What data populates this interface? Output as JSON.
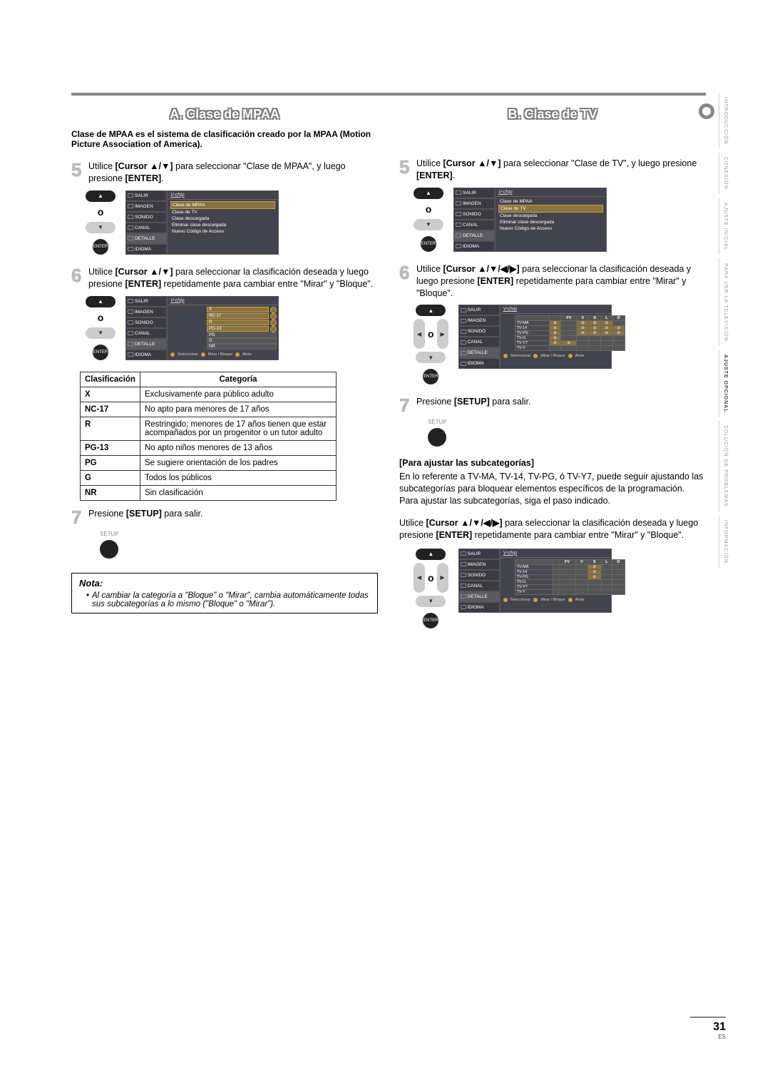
{
  "page": {
    "number": "31",
    "lang": "ES"
  },
  "sidetabs": [
    "INTRODUCCIÓN",
    "CONEXIÓN",
    "AJUSTE INICIAL",
    "PARA VER LA TELEVISIÓN",
    "AJUSTE OPCIONAL",
    "SOLUCIÓN DE PROBLEMAS",
    "INFORMACIÓN"
  ],
  "active_tab_index": 4,
  "sectionA": {
    "title": "A.  Clase de MPAA",
    "intro": "Clase de MPAA es el sistema de clasificación creado por la MPAA (Motion Picture Association of America).",
    "step5_pre": "Utilice ",
    "step5_cmd": "[Cursor ▲/▼]",
    "step5_post": " para seleccionar \"Clase de MPAA\", y luego presione ",
    "enter": "[ENTER]",
    "period": ".",
    "step6_pre": "Utilice ",
    "step6_cmd": "[Cursor ▲/▼]",
    "step6_post": " para seleccionar la clasificación deseada y luego presione ",
    "step6_tail": " repetidamente para cambiar entre \"Mirar\" y \"Bloque\".",
    "step7_pre": "Presione ",
    "setup": "[SETUP]",
    "step7_post": " para salir.",
    "setup_label": "SETUP",
    "table_h1": "Clasificación",
    "table_h2": "Categoría",
    "rows": [
      {
        "c": "X",
        "d": "Exclusivamente para público adulto"
      },
      {
        "c": "NC-17",
        "d": "No apto para menores de 17 años"
      },
      {
        "c": "R",
        "d": "Restringido; menores de 17 años tienen que estar acompañados por un progenitor o un tutor adulto"
      },
      {
        "c": "PG-13",
        "d": "No apto niños menores de 13 años"
      },
      {
        "c": "PG",
        "d": "Se sugiere orientación de los padres"
      },
      {
        "c": "G",
        "d": "Todos los públicos"
      },
      {
        "c": "NR",
        "d": "Sin clasificación"
      }
    ],
    "note_title": "Nota:",
    "note_body": "Al cambiar la categoría a \"Bloque\" o \"Mirar\", cambia automáticamente todas sus subcategorías a lo mismo (\"Bloque\" o \"Mirar\")."
  },
  "sectionB": {
    "title": "B.  Clase de TV",
    "step5_pre": "Utilice ",
    "step5_cmd": "[Cursor ▲/▼]",
    "step5_post": " para seleccionar \"Clase de TV\", y luego presione ",
    "enter": "[ENTER]",
    "period": ".",
    "step6_pre": "Utilice ",
    "step6_cmd": "[Cursor ▲/▼/◀/▶]",
    "step6_post": " para seleccionar la clasificación deseada y luego presione ",
    "step6_tail": " repetidamente para cambiar entre \"Mirar\" y \"Bloque\".",
    "step7_pre": "Presione ",
    "setup": "[SETUP]",
    "step7_post": " para salir.",
    "setup_label": "SETUP",
    "sub_title": "Para ajustar las subcategorías]",
    "sub_title_pre": "[",
    "sub_body": "En lo referente a TV-MA, TV-14, TV-PG, ó TV-Y7, puede seguir ajustando las subcategorías para bloquear elementos específicos de la programación. Para ajustar las subcategorías, siga el paso indicado.",
    "sub2_pre": "Utilice ",
    "sub2_cmd": "[Cursor ▲/▼/◀/▶]",
    "sub2_post": " para seleccionar la clasificación deseada y luego presione ",
    "sub2_tail": " repetidamente para cambiar entre \"Mirar\" y \"Bloque\"."
  },
  "tv_menu": {
    "title": "V-chip",
    "side": [
      "SALIR",
      "IMAGEN",
      "SONIDO",
      "CANAL",
      "DETALLE",
      "IDIOMA"
    ],
    "opts": [
      "Clase de MPAA",
      "Clase de TV",
      "Clase descargada",
      "Eliminar clase descargada",
      "Nuevo Código de Acceso"
    ],
    "footer": [
      "Seleccionar",
      "Mirar / Bloque",
      "Atrás"
    ]
  },
  "tv_grid": {
    "cols": [
      "FV",
      "V",
      "S",
      "L",
      "D"
    ],
    "rows": [
      "TV-MA",
      "TV-14",
      "TV-PG",
      "TV-G",
      "TV-Y7",
      "TV-Y"
    ]
  },
  "mpaa_list": [
    "X",
    "NC-17",
    "R",
    "PG-13",
    "PG",
    "G",
    "NR"
  ],
  "enter_label": "ENTER"
}
